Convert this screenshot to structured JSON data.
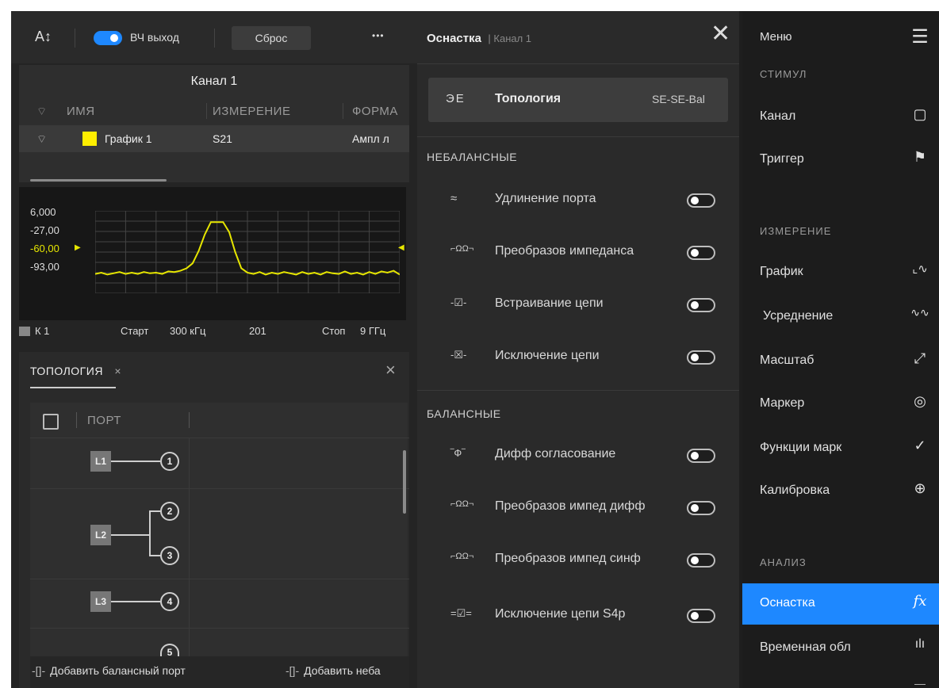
{
  "toolbar": {
    "font_icon": "A↕",
    "rf_output_label": "ВЧ выход",
    "rf_output_on": true,
    "reset_label": "Сброс",
    "more_label": "•••"
  },
  "channel_panel": {
    "title": "Канал 1",
    "columns": [
      "ИМЯ",
      "ИЗМЕРЕНИЕ",
      "ФОРМА"
    ],
    "rows": [
      {
        "name": "График 1",
        "measurement": "S21",
        "format": "Ампл л",
        "color": "#ffee00"
      }
    ]
  },
  "chart_data": {
    "type": "line",
    "y_tick_labels": [
      "6,000",
      "-27,00",
      "-60,00",
      "-93,00"
    ],
    "ref_level_label": "-60,00",
    "ylim": [
      -126,
      6
    ],
    "xlim": [
      0,
      100
    ],
    "grid": true,
    "line_color": "#e6e600",
    "x": [
      0,
      2,
      4,
      6,
      8,
      10,
      12,
      14,
      16,
      18,
      20,
      22,
      24,
      26,
      28,
      30,
      32,
      34,
      36,
      38,
      40,
      42,
      44,
      46,
      48,
      50,
      52,
      54,
      56,
      58,
      60,
      62,
      64,
      66,
      68,
      70,
      72,
      74,
      76,
      78,
      80,
      82,
      84,
      86,
      88,
      90,
      92,
      94,
      96,
      98,
      100
    ],
    "values": [
      -95,
      -93,
      -96,
      -94,
      -92,
      -95,
      -93,
      -95,
      -92,
      -94,
      -93,
      -95,
      -91,
      -92,
      -90,
      -86,
      -78,
      -58,
      -32,
      -12,
      -12,
      -12,
      -28,
      -60,
      -86,
      -93,
      -95,
      -92,
      -96,
      -93,
      -95,
      -92,
      -94,
      -96,
      -92,
      -95,
      -93,
      -96,
      -92,
      -94,
      -95,
      -91,
      -95,
      -93,
      -96,
      -92,
      -95,
      -91,
      -93,
      -90,
      -96
    ]
  },
  "status": {
    "channel_label": "К 1",
    "start_label": "Старт",
    "start_value": "300 кГц",
    "points": "201",
    "stop_label": "Стоп",
    "stop_value": "9 ГГц"
  },
  "topology_panel": {
    "tab_label": "ТОПОЛОГИЯ",
    "column_header": "ПОРТ",
    "ports": [
      {
        "logical": "L1",
        "physical": [
          "1"
        ]
      },
      {
        "logical": "L2",
        "physical": [
          "2",
          "3"
        ]
      },
      {
        "logical": "L3",
        "physical": [
          "4"
        ]
      },
      {
        "logical": "",
        "physical": [
          "5"
        ]
      }
    ],
    "add_balanced_label": "Добавить балансный порт",
    "add_unbalanced_label": "Добавить неба"
  },
  "fixture_panel": {
    "title": "Оснастка",
    "subtitle": "| Канал 1",
    "topology_label": "Топология",
    "topology_value": "SE-SE-Bal",
    "topology_icon": "ЭЕ",
    "unbalanced_header": "НЕБАЛАНСНЫЕ",
    "unbalanced_items": [
      {
        "label": "Удлинение порта",
        "icon": "port-extension-icon",
        "glyph": "≈",
        "on": false
      },
      {
        "label": "Преобразов импеданса",
        "icon": "impedance-conversion-icon",
        "glyph": "⌐ΩΩ¬",
        "on": false
      },
      {
        "label": "Встраивание цепи",
        "icon": "embedding-icon",
        "glyph": "-☑-",
        "on": false
      },
      {
        "label": "Исключение цепи",
        "icon": "de-embedding-icon",
        "glyph": "-☒-",
        "on": false
      }
    ],
    "balanced_header": "БАЛАНСНЫЕ",
    "balanced_items": [
      {
        "label": "Дифф согласование",
        "icon": "diff-matching-icon",
        "glyph": "‾Ф‾",
        "on": false
      },
      {
        "label": "Преобразов импед дифф",
        "icon": "diff-impedance-icon",
        "glyph": "⌐ΩΩ¬",
        "on": false
      },
      {
        "label": "Преобразов импед синф",
        "icon": "common-impedance-icon",
        "glyph": "⌐ΩΩ¬",
        "on": false
      },
      {
        "label": "Исключение цепи S4p",
        "icon": "s4p-deembed-icon",
        "glyph": "=☑=",
        "on": false
      }
    ]
  },
  "menu": {
    "title": "Меню",
    "sections": [
      {
        "header": "СТИМУЛ",
        "items": [
          {
            "label": "Канал",
            "icon": "channel-icon",
            "glyph": "▢"
          },
          {
            "label": "Триггер",
            "icon": "trigger-flag-icon",
            "glyph": "⚑"
          }
        ]
      },
      {
        "header": "ИЗМЕРЕНИЕ",
        "items": [
          {
            "label": "График",
            "icon": "graph-icon",
            "glyph": "⌞∿"
          },
          {
            "label": "Усреднение",
            "icon": "averaging-icon",
            "glyph": "∿∿"
          },
          {
            "label": "Масштаб",
            "icon": "scale-icon",
            "glyph": "⤢"
          },
          {
            "label": "Маркер",
            "icon": "marker-icon",
            "glyph": "◎"
          },
          {
            "label": "Функции марк",
            "icon": "marker-functions-icon",
            "glyph": "✓"
          },
          {
            "label": "Калибровка",
            "icon": "calibration-icon",
            "glyph": "⊕"
          }
        ]
      },
      {
        "header": "АНАЛИЗ",
        "items": [
          {
            "label": "Оснастка",
            "icon": "fx-icon",
            "glyph": "fx",
            "active": true
          },
          {
            "label": "Временная обл",
            "icon": "time-domain-icon",
            "glyph": "ılı"
          }
        ]
      }
    ]
  },
  "colors": {
    "accent": "#1e88ff",
    "trace": "#e6e600"
  }
}
